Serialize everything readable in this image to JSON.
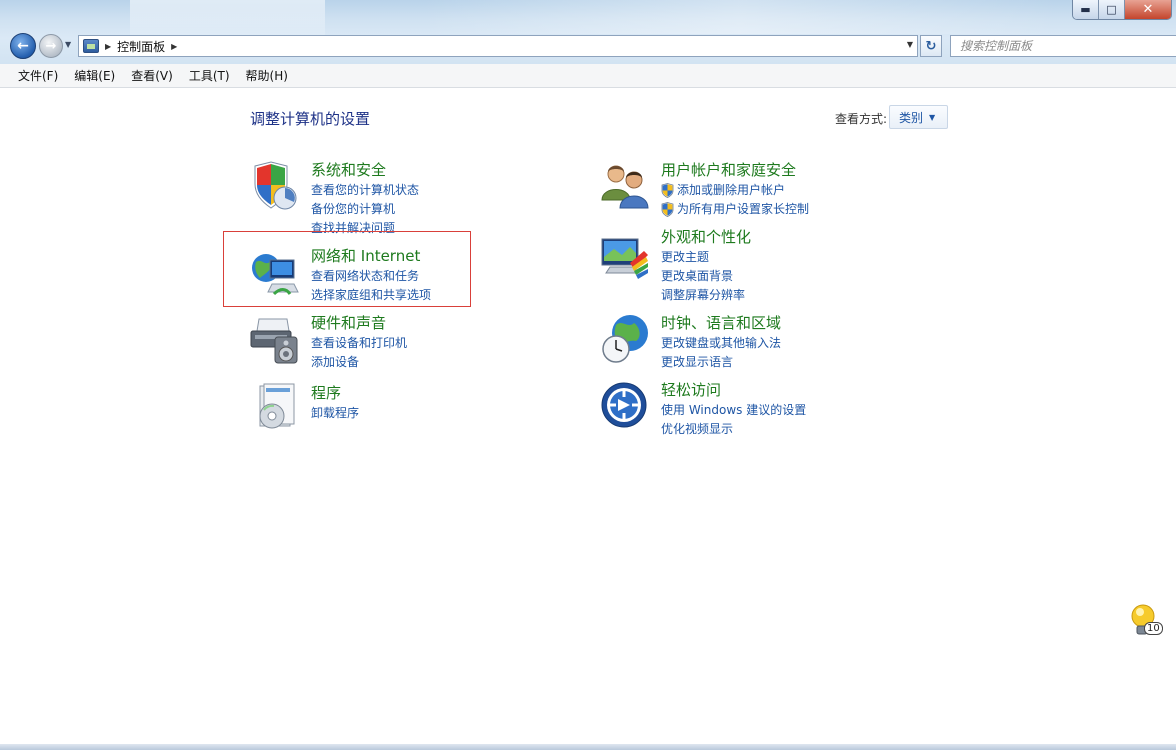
{
  "window": {
    "minimize": "▬",
    "maximize": "□",
    "close": "✕"
  },
  "address": {
    "crumb": "控制面板",
    "search_placeholder": "搜索控制面板"
  },
  "menu": [
    "文件(F)",
    "编辑(E)",
    "查看(V)",
    "工具(T)",
    "帮助(H)"
  ],
  "content": {
    "heading": "调整计算机的设置",
    "view_by_label": "查看方式:",
    "view_by_value": "类别"
  },
  "categories": [
    {
      "title": "系统和安全",
      "links": [
        "查看您的计算机状态",
        "备份您的计算机",
        "查找并解决问题"
      ]
    },
    {
      "title": "网络和 Internet",
      "links": [
        "查看网络状态和任务",
        "选择家庭组和共享选项"
      ]
    },
    {
      "title": "硬件和声音",
      "links": [
        "查看设备和打印机",
        "添加设备"
      ]
    },
    {
      "title": "程序",
      "links": [
        "卸载程序"
      ]
    },
    {
      "title": "用户帐户和家庭安全",
      "links": [
        "添加或删除用户帐户",
        "为所有用户设置家长控制"
      ]
    },
    {
      "title": "外观和个性化",
      "links": [
        "更改主题",
        "更改桌面背景",
        "调整屏幕分辨率"
      ]
    },
    {
      "title": "时钟、语言和区域",
      "links": [
        "更改键盘或其他输入法",
        "更改显示语言"
      ]
    },
    {
      "title": "轻松访问",
      "links": [
        "使用 Windows 建议的设置",
        "优化视频显示"
      ]
    }
  ],
  "tray": {
    "badge": "10"
  },
  "icons": {
    "back": "back-arrow-icon",
    "forward": "forward-arrow-icon",
    "refresh": "refresh-icon",
    "shield": "uac-shield-icon"
  }
}
